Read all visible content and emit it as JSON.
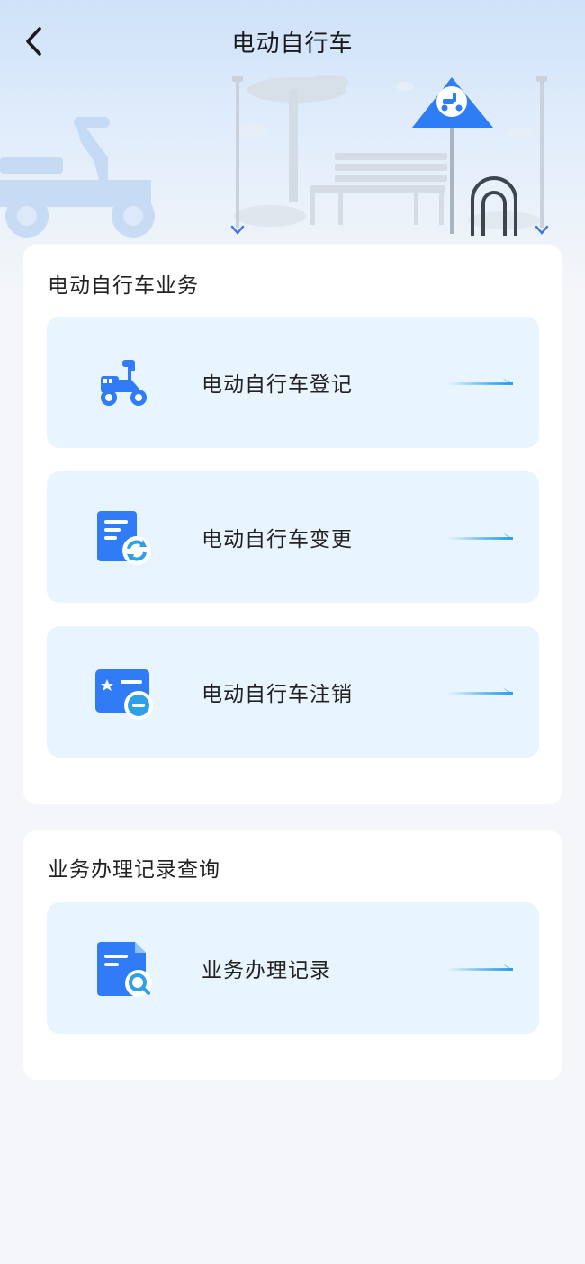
{
  "header": {
    "title": "电动自行车"
  },
  "sections": [
    {
      "title": "电动自行车业务",
      "items": [
        {
          "label": "电动自行车登记",
          "icon": "scooter-icon"
        },
        {
          "label": "电动自行车变更",
          "icon": "document-refresh-icon"
        },
        {
          "label": "电动自行车注销",
          "icon": "card-minus-icon"
        }
      ]
    },
    {
      "title": "业务办理记录查询",
      "items": [
        {
          "label": "业务办理记录",
          "icon": "document-search-icon"
        }
      ]
    }
  ],
  "colors": {
    "accent": "#2f7cf6",
    "item_bg": "#e9f5fe",
    "arrow": "#2ea0e8"
  }
}
